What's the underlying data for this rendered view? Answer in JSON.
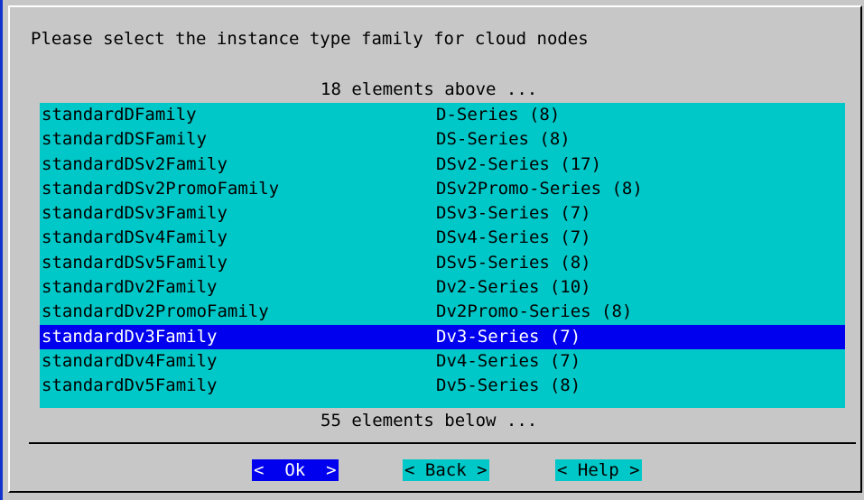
{
  "dialog": {
    "prompt": "Please select the instance type family for cloud nodes",
    "more_above": "18 elements above ...",
    "more_below": "55 elements below ...",
    "items": [
      {
        "tag": "standardDFamily",
        "desc": "D-Series (8)"
      },
      {
        "tag": "standardDSFamily",
        "desc": "DS-Series (8)"
      },
      {
        "tag": "standardDSv2Family",
        "desc": "DSv2-Series (17)"
      },
      {
        "tag": "standardDSv2PromoFamily",
        "desc": "DSv2Promo-Series (8)"
      },
      {
        "tag": "standardDSv3Family",
        "desc": "DSv3-Series (7)"
      },
      {
        "tag": "standardDSv4Family",
        "desc": "DSv4-Series (7)"
      },
      {
        "tag": "standardDSv5Family",
        "desc": "DSv5-Series (8)"
      },
      {
        "tag": "standardDv2Family",
        "desc": "Dv2-Series (10)"
      },
      {
        "tag": "standardDv2PromoFamily",
        "desc": "Dv2Promo-Series (8)"
      },
      {
        "tag": "standardDv3Family",
        "desc": "Dv3-Series (7)",
        "selected": true
      },
      {
        "tag": "standardDv4Family",
        "desc": "Dv4-Series (7)"
      },
      {
        "tag": "standardDv5Family",
        "desc": "Dv5-Series (8)"
      }
    ],
    "buttons": {
      "ok": "<  Ok  >",
      "back": "< Back >",
      "help": "< Help >"
    }
  },
  "colors": {
    "background": "#c7c7c7",
    "list_background": "#00c8c8",
    "selection": "#0000ee",
    "frame_accent": "#1133cc"
  }
}
